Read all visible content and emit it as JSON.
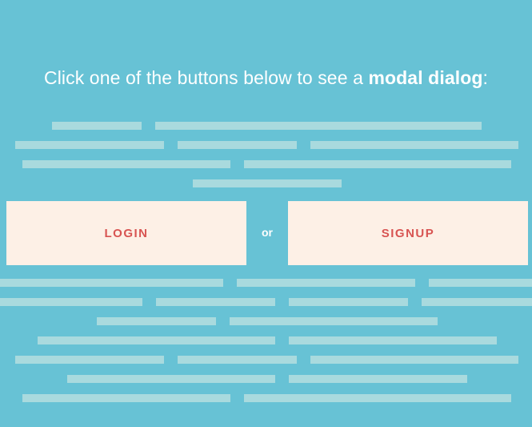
{
  "headline": {
    "prefix": "Click one of the buttons below to see a ",
    "emphasis": "modal dialog",
    "suffix": ":"
  },
  "buttons": {
    "login_label": "LOGIN",
    "separator": "or",
    "signup_label": "SIGNUP"
  },
  "colors": {
    "background": "#67c2d5",
    "placeholder_bar": "#a9dade",
    "button_fill": "#fdf0e6",
    "button_text": "#d85452",
    "headline_text": "#ffffff"
  }
}
